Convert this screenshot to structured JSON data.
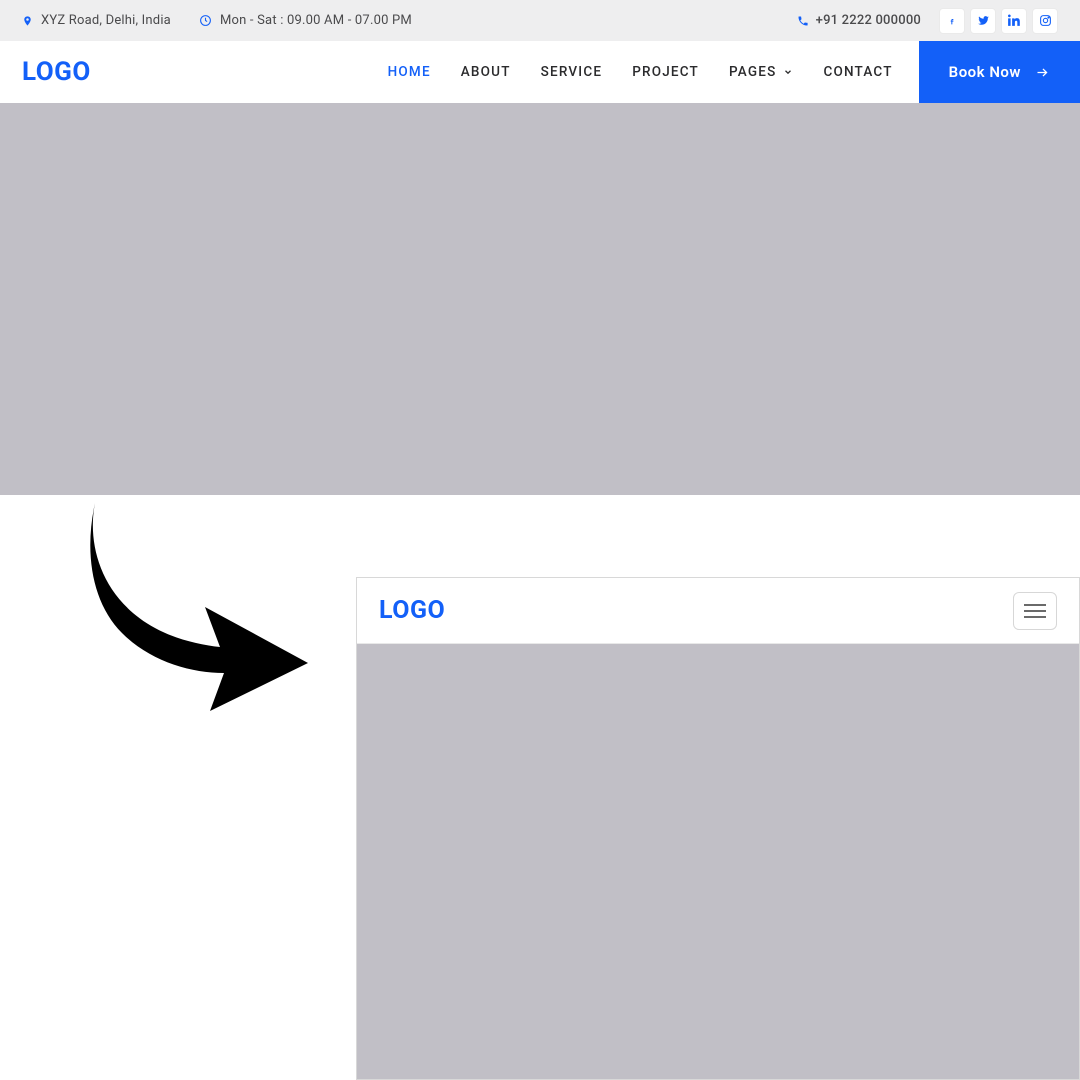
{
  "topbar": {
    "address": "XYZ Road, Delhi, India",
    "hours": "Mon - Sat : 09.00 AM - 07.00 PM",
    "phone": "+91 2222 000000"
  },
  "brand": {
    "logo_text": "LOGO"
  },
  "nav": {
    "items": [
      {
        "label": "HOME",
        "active": true
      },
      {
        "label": "ABOUT"
      },
      {
        "label": "SERVICE"
      },
      {
        "label": "PROJECT"
      },
      {
        "label": "PAGES",
        "dropdown": true
      },
      {
        "label": "CONTACT"
      }
    ],
    "cta": "Book Now"
  },
  "mobile_preview": {
    "logo_text": "LOGO"
  }
}
